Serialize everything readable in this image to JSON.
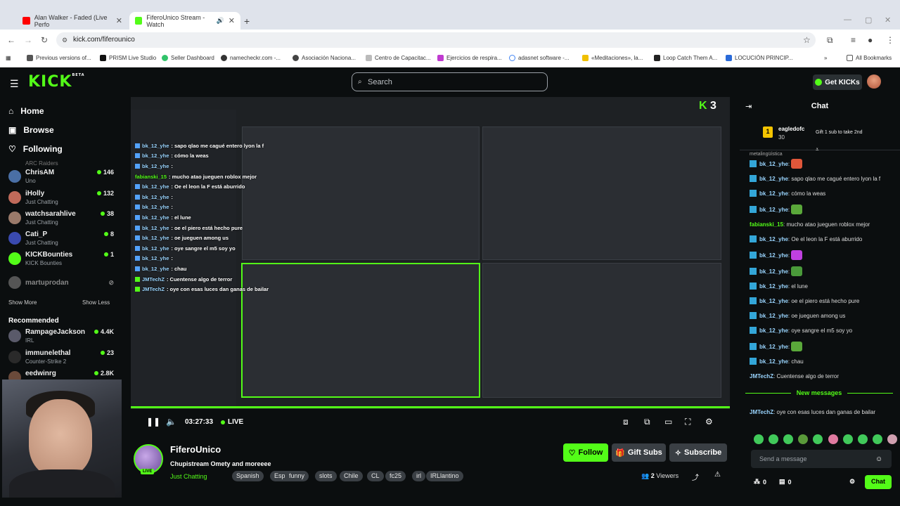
{
  "browser": {
    "tabs": [
      {
        "title": "Alan Walker - Faded (Live Perfo",
        "color": "#ff0000"
      },
      {
        "title": "FiferoUnico Stream - Watch",
        "color": "#53fc18"
      }
    ],
    "url": "kick.com/fiferounico",
    "bookmarks": [
      "Previous versions of...",
      "PRISM Live Studio",
      "Seller Dashboard",
      "namecheckr.com -...",
      "Asociación Naciona...",
      "Centro de Capacitac...",
      "Ejercicios de respira...",
      "adasnet software -...",
      "«Meditaciones», la...",
      "Loop Catch Them A...",
      "LOCUCIÓN PRINCIP...",
      "All Bookmarks"
    ]
  },
  "header": {
    "logo": "KICK",
    "logo_beta": "BETA",
    "search_placeholder": "Search",
    "get_kicks": "Get KICKs"
  },
  "sidebar": {
    "nav": [
      {
        "label": "Home",
        "icon": "home-icon"
      },
      {
        "label": "Browse",
        "icon": "browse-icon"
      },
      {
        "label": "Following",
        "icon": "heart-icon"
      }
    ],
    "following_clip": "ARC Raiders",
    "following": [
      {
        "name": "ChrisAM",
        "category": "Uno",
        "viewers": "146",
        "color": "#4a6fa5"
      },
      {
        "name": "iHolly",
        "category": "Just Chatting",
        "viewers": "132",
        "color": "#c06a5a"
      },
      {
        "name": "watchsarahlive",
        "category": "Just Chatting",
        "viewers": "38",
        "color": "#9a7a6a"
      },
      {
        "name": "Cati_P",
        "category": "Just Chatting",
        "viewers": "8",
        "color": "#3a4ab0"
      },
      {
        "name": "KICKBounties",
        "category": "KICK Bounties",
        "viewers": "1",
        "color": "#53fc18"
      }
    ],
    "offline": "martuprodan",
    "show_more": "Show More",
    "show_less": "Show Less",
    "recommended_title": "Recommended",
    "recommended": [
      {
        "name": "RampageJackson",
        "category": "IRL",
        "viewers": "4.4K",
        "color": "#5a5a6a"
      },
      {
        "name": "immunelethal",
        "category": "Counter-Strike 2",
        "viewers": "23",
        "color": "#2a2a2a"
      },
      {
        "name": "eedwinrg",
        "category": "",
        "viewers": "2.8K",
        "color": "#6a4a3a"
      }
    ]
  },
  "video": {
    "chat_overlay": [
      {
        "user": "bk_12_yhe",
        "text": ": sapo qlao me cagué entero lyon la f"
      },
      {
        "user": "bk_12_yhe",
        "text": ": cómo la weas"
      },
      {
        "user": "bk_12_yhe",
        "text": ":"
      },
      {
        "user": "fabianski_15",
        "text": ": mucho atao jueguen roblox mejor"
      },
      {
        "user": "bk_12_yhe",
        "text": ": Oe el leon la F está aburrido"
      },
      {
        "user": "bk_12_yhe",
        "text": ":"
      },
      {
        "user": "bk_12_yhe",
        "text": ":"
      },
      {
        "user": "bk_12_yhe",
        "text": ": el lune"
      },
      {
        "user": "bk_12_yhe",
        "text": ": oe el piero está hecho pure"
      },
      {
        "user": "bk_12_yhe",
        "text": ": oe jueguen among us"
      },
      {
        "user": "bk_12_yhe",
        "text": ": oye sangre el m5 soy yo"
      },
      {
        "user": "bk_12_yhe",
        "text": ":"
      },
      {
        "user": "bk_12_yhe",
        "text": ": chau"
      },
      {
        "user": "JMTechZ",
        "text": ": Cuentense algo de terror"
      },
      {
        "user": "JMTechZ",
        "text": ": oye con esas luces dan ganas de bailar"
      }
    ],
    "overlay_badge": "3",
    "time": "03:27:33",
    "live_label": "LIVE"
  },
  "stream": {
    "streamer": "FiferoUnico",
    "live_badge": "LIVE",
    "title": "Chupistream Omety and moreeee",
    "category": "Just Chatting",
    "tags": [
      "Spanish",
      "Español",
      "funny",
      "slots",
      "Chile",
      "CL",
      "fc25",
      "irl",
      "IRLlantino"
    ],
    "follow": "Follow",
    "gift_subs": "Gift Subs",
    "subscribe": "Subscribe",
    "viewers_count": "2",
    "viewers_label": "Viewers"
  },
  "chat": {
    "title": "Chat",
    "pinned": {
      "rank": "1",
      "user": "eagledofc",
      "amount": "30",
      "text": "Gift 1 sub to take 2nd"
    },
    "clip_text": "metalingüística",
    "messages": [
      {
        "user": "bk_12_yhe",
        "text": "",
        "emote": "#e0573a"
      },
      {
        "user": "bk_12_yhe",
        "text": "sapo qlao me cagué entero lyon la f"
      },
      {
        "user": "bk_12_yhe",
        "text": "cómo la weas"
      },
      {
        "user": "bk_12_yhe",
        "text": "",
        "emote": "#5aa83a"
      },
      {
        "user": "fabianski_15",
        "text": "mucho atao jueguen roblox mejor",
        "nobadge": true
      },
      {
        "user": "bk_12_yhe",
        "text": "Oe el leon la F está aburrido"
      },
      {
        "user": "bk_12_yhe",
        "text": "",
        "emote": "#c040e0"
      },
      {
        "user": "bk_12_yhe",
        "text": "",
        "emote": "#4a9a3a"
      },
      {
        "user": "bk_12_yhe",
        "text": "el lune"
      },
      {
        "user": "bk_12_yhe",
        "text": "oe el piero está hecho pure"
      },
      {
        "user": "bk_12_yhe",
        "text": "oe jueguen among us"
      },
      {
        "user": "bk_12_yhe",
        "text": "oye sangre el m5 soy yo"
      },
      {
        "user": "bk_12_yhe",
        "text": "",
        "emote": "#5aa83a"
      },
      {
        "user": "bk_12_yhe",
        "text": "chau"
      },
      {
        "user": "JMTechZ",
        "text": "Cuentense algo de terror",
        "nobadge": true
      }
    ],
    "new_messages": "New messages",
    "last": {
      "user": "JMTechZ",
      "text": "oye con esas luces dan ganas de bailar"
    },
    "input_placeholder": "Send a message",
    "kicks_count": "0",
    "gift_count": "0",
    "send": "Chat"
  }
}
